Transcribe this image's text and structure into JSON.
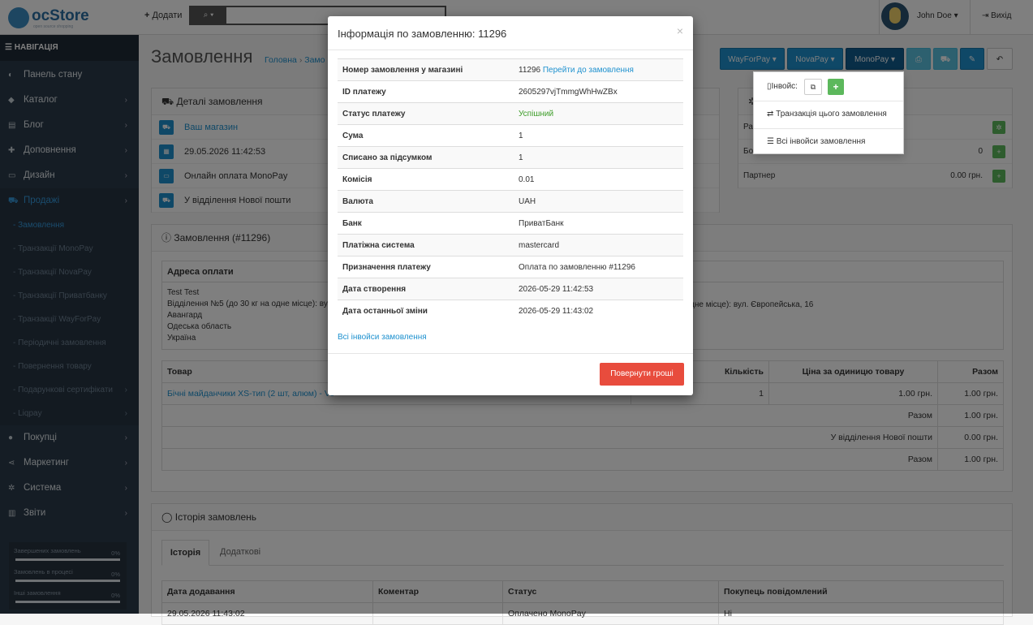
{
  "header": {
    "logo_main": "ocStore",
    "logo_sub": "open source shopping",
    "add_label": "Додати",
    "user_name": "John Doe",
    "logout_label": "Вихід"
  },
  "sidebar": {
    "title": "НАВІГАЦІЯ",
    "items": [
      {
        "label": "Панель стану",
        "icon": "dashboard-icon"
      },
      {
        "label": "Каталог",
        "icon": "tag-icon"
      },
      {
        "label": "Блог",
        "icon": "book-icon"
      },
      {
        "label": "Доповнення",
        "icon": "puzzle-icon"
      },
      {
        "label": "Дизайн",
        "icon": "monitor-icon"
      },
      {
        "label": "Продажі",
        "icon": "cart-icon"
      }
    ],
    "sales_sub": [
      "Замовлення",
      "Транзакції MonoPay",
      "Транзакції NovaPay",
      "Транзакції Приватбанку",
      "Транзакції WayForPay",
      "Періодичні замовлення",
      "Повернення товару",
      "Подарункові сертифікати",
      "Liqpay"
    ],
    "items2": [
      {
        "label": "Покупці",
        "icon": "user-icon"
      },
      {
        "label": "Маркетинг",
        "icon": "share-icon"
      },
      {
        "label": "Система",
        "icon": "cog-icon"
      },
      {
        "label": "Звіти",
        "icon": "bar-chart-icon"
      }
    ],
    "stats": [
      {
        "label": "Завершених замовлень",
        "percent": "0%"
      },
      {
        "label": "Замовлень в процесі",
        "percent": "0%"
      },
      {
        "label": "Інші замовлення",
        "percent": "0%"
      }
    ]
  },
  "page": {
    "title": "Замовлення",
    "crumb_home": "Головна",
    "crumb_sep": "›",
    "crumb_current": "Замо",
    "toolbar": {
      "wayforpay": "WayForPay",
      "novapay": "NovaPay",
      "monopay": "MonoPay"
    }
  },
  "dropdown": {
    "invoice_label": "Інвойс:",
    "transaction_label": "Транзакція цього замовлення",
    "all_invoices_label": "Всі інвойси замовлення"
  },
  "details": {
    "title": "Деталі замовлення",
    "rows": [
      "Ваш магазин",
      "29.05.2026 11:42:53",
      "Онлайн оплата MonoPay",
      "У відділення Нової пошти"
    ]
  },
  "right_panel": {
    "rows": [
      {
        "label": "Ра",
        "value": ""
      },
      {
        "label": "Бо",
        "value": "0"
      },
      {
        "label": "Партнер",
        "value": "0.00 грн."
      }
    ]
  },
  "order": {
    "title": "Замовлення (#11296)",
    "address_header": "Адреса оплати",
    "address_lines": [
      "Test Test",
      "Відділення №5 (до 30 кг на одне місце): ву",
      "Авангард",
      "Одеська область",
      "Україна"
    ],
    "shipping_line": "дне місце): вул. Європейська, 16",
    "table_headers": {
      "product": "Товар",
      "qty": "Кількість",
      "price": "Ціна за одиницю товару",
      "total": "Разом"
    },
    "product_name": "Бічні майданчики XS-тип (2 шт, алюм) - Vo",
    "product_qty": "1",
    "product_price": "1.00 грн.",
    "product_total": "1.00 грн.",
    "summary": [
      {
        "label": "Разом",
        "value": "1.00 грн."
      },
      {
        "label": "У відділення Нової пошти",
        "value": "0.00 грн."
      },
      {
        "label": "Разом",
        "value": "1.00 грн."
      }
    ]
  },
  "history": {
    "title": "Історія замовлень",
    "tabs": [
      "Історія",
      "Додаткові"
    ],
    "headers": [
      "Дата додавання",
      "Коментар",
      "Статус",
      "Покупець повідомлений"
    ],
    "row": [
      "29.05.2026 11:43:02",
      "",
      "Оплачено MonoPay",
      "Ні"
    ]
  },
  "modal": {
    "title": "Інформація по замовленню: 11296",
    "close": "×",
    "rows": [
      {
        "label": "Номер замовлення у магазині",
        "value": "11296",
        "link": "Перейти до замовлення"
      },
      {
        "label": "ID платежу",
        "value": "2605297vjTmmgWhHwZBx"
      },
      {
        "label": "Статус платежу",
        "value": "Успішний"
      },
      {
        "label": "Сума",
        "value": "1"
      },
      {
        "label": "Списано за підсумком",
        "value": "1"
      },
      {
        "label": "Комісія",
        "value": "0.01"
      },
      {
        "label": "Валюта",
        "value": "UAH"
      },
      {
        "label": "Банк",
        "value": "ПриватБанк"
      },
      {
        "label": "Платіжна система",
        "value": "mastercard"
      },
      {
        "label": "Призначення платежу",
        "value": "Оплата по замовленню #11296"
      },
      {
        "label": "Дата створення",
        "value": "2026-05-29 11:42:53"
      },
      {
        "label": "Дата останньої зміни",
        "value": "2026-05-29 11:43:02"
      }
    ],
    "all_invoices_link": "Всі інвойси замовлення",
    "refund_button": "Повернути гроші"
  }
}
